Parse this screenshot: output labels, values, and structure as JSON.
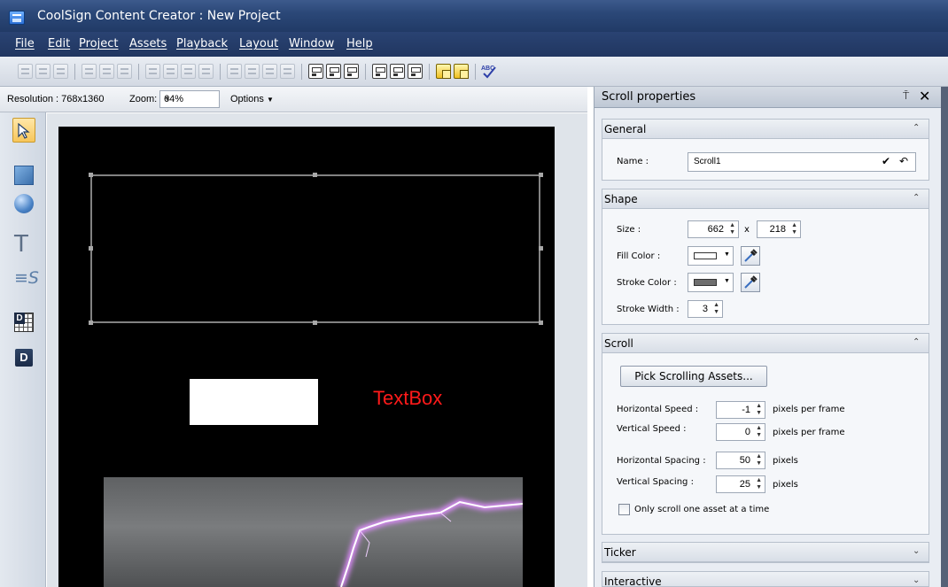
{
  "window": {
    "title": "CoolSign Content Creator : New Project"
  },
  "menu": [
    "File",
    "Edit",
    "Project",
    "Assets",
    "Playback",
    "Layout",
    "Window",
    "Help"
  ],
  "canvas_bar": {
    "resolution_label": "Resolution : 768x1360",
    "zoom_label": "Zoom:",
    "zoom_value": "64%",
    "options_label": "Options"
  },
  "tools": [
    "select-tool",
    "rectangle-tool",
    "ellipse-tool",
    "text-tool",
    "scroll-text-tool",
    "grid-tool",
    "data-tool"
  ],
  "canvas": {
    "textbox_label": "TextBox"
  },
  "properties": {
    "title": "Scroll properties",
    "pin_glyph": "⍑",
    "close_glyph": "✕",
    "expand_glyph": "⌃",
    "collapse_glyph": "⌄",
    "general": {
      "header": "General",
      "name_label": "Name :",
      "name_value": "Scroll1",
      "confirm_glyph": "✔",
      "undo_glyph": "↶"
    },
    "shape": {
      "header": "Shape",
      "size_label": "Size :",
      "width": "662",
      "x_sep": "x",
      "height": "218",
      "fill_label": "Fill Color :",
      "fill_color": "#ffffff",
      "stroke_label": "Stroke Color :",
      "stroke_color": "#6e6e6e",
      "stroke_width_label": "Stroke Width :",
      "stroke_width": "3"
    },
    "scroll": {
      "header": "Scroll",
      "pick_button": "Pick Scrolling Assets...",
      "h_speed_label": "Horizontal Speed :",
      "h_speed": "-1",
      "h_speed_unit": "pixels per frame",
      "v_speed_label": "Vertical Speed :",
      "v_speed": "0",
      "v_speed_unit": "pixels per frame",
      "h_spacing_label": "Horizontal Spacing :",
      "h_spacing": "50",
      "h_spacing_unit": "pixels",
      "v_spacing_label": "Vertical Spacing :",
      "v_spacing": "25",
      "v_spacing_unit": "pixels",
      "one_asset_label": "Only scroll one asset at a time"
    },
    "ticker": {
      "header": "Ticker"
    },
    "interactive": {
      "header": "Interactive"
    }
  }
}
